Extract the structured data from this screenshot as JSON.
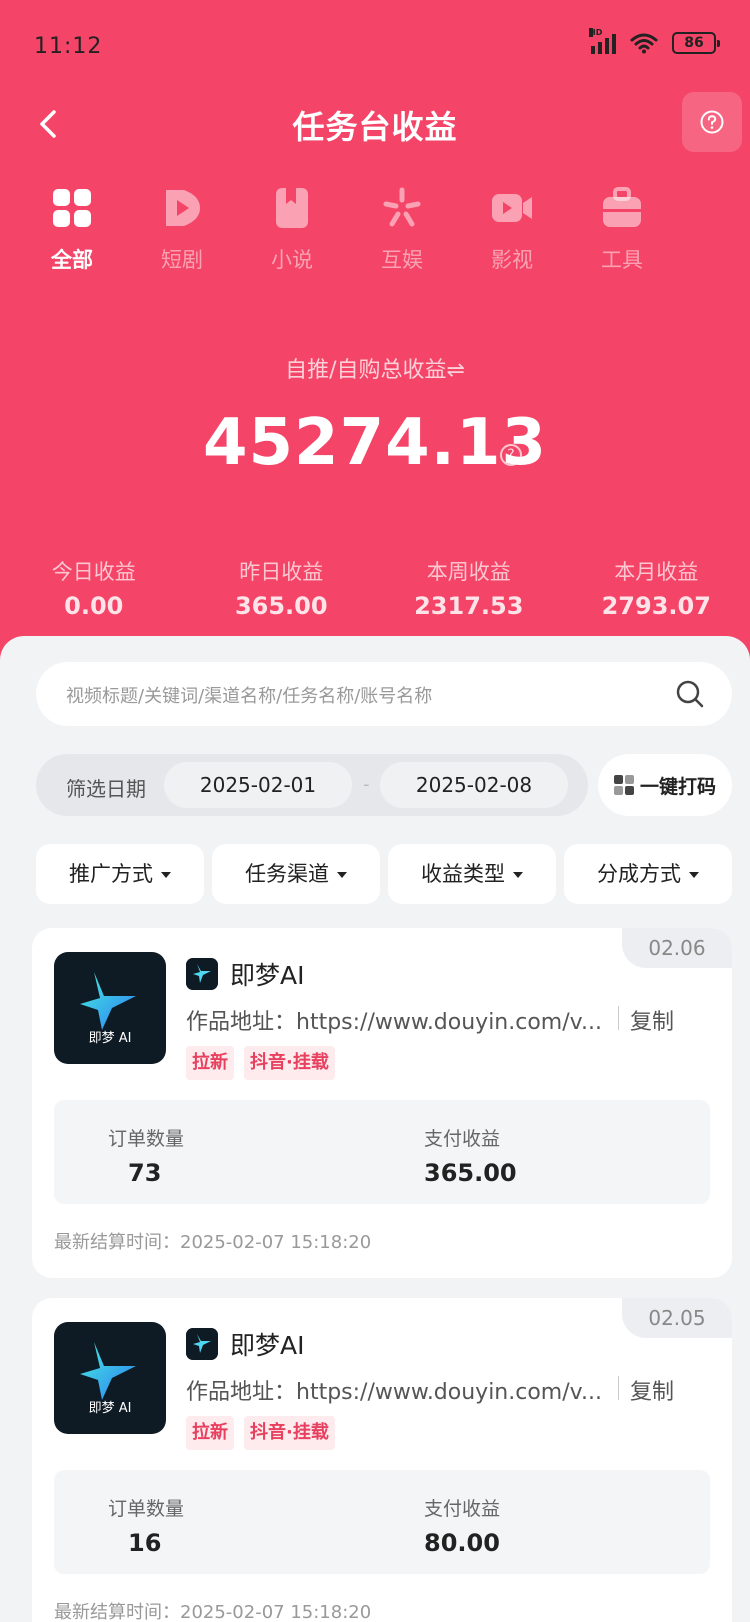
{
  "status_bar": {
    "time": "11:12",
    "network": "HD",
    "battery": "86"
  },
  "header": {
    "title": "任务台收益"
  },
  "categories": [
    {
      "label": "全部",
      "icon": "grid-icon",
      "active": true
    },
    {
      "label": "短剧",
      "icon": "play-icon",
      "active": false
    },
    {
      "label": "小说",
      "icon": "book-icon",
      "active": false
    },
    {
      "label": "互娱",
      "icon": "sparkle-icon",
      "active": false
    },
    {
      "label": "影视",
      "icon": "video-icon",
      "active": false
    },
    {
      "label": "工具",
      "icon": "toolbox-icon",
      "active": false
    }
  ],
  "summary": {
    "label": "自推/自购总收益⇌",
    "total": "45274.13",
    "stats": [
      {
        "label": "今日收益",
        "value": "0.00"
      },
      {
        "label": "昨日收益",
        "value": "365.00"
      },
      {
        "label": "本周收益",
        "value": "2317.53"
      },
      {
        "label": "本月收益",
        "value": "2793.07"
      }
    ]
  },
  "search": {
    "placeholder": "视频标题/关键词/渠道名称/任务名称/账号名称"
  },
  "date_filter": {
    "label": "筛选日期",
    "start": "2025-02-01",
    "separator": "-",
    "end": "2025-02-08"
  },
  "qr_button": {
    "label": "一键打码"
  },
  "filters": [
    {
      "label": "推广方式"
    },
    {
      "label": "任务渠道"
    },
    {
      "label": "收益类型"
    },
    {
      "label": "分成方式"
    }
  ],
  "cards": [
    {
      "date": "02.06",
      "logo_text": "即梦 AI",
      "app_name": "即梦AI",
      "address": "作品地址：https://www.douyin.com/v...",
      "copy_label": "复制",
      "tags": [
        "拉新",
        "抖音·挂载"
      ],
      "order_label": "订单数量",
      "order_value": "73",
      "pay_label": "支付收益",
      "pay_value": "365.00",
      "settle": "最新结算时间：2025-02-07 15:18:20"
    },
    {
      "date": "02.05",
      "logo_text": "即梦 AI",
      "app_name": "即梦AI",
      "address": "作品地址：https://www.douyin.com/v...",
      "copy_label": "复制",
      "tags": [
        "拉新",
        "抖音·挂载"
      ],
      "order_label": "订单数量",
      "order_value": "16",
      "pay_label": "支付收益",
      "pay_value": "80.00",
      "settle": "最新结算时间：2025-02-07 15:18:20"
    }
  ],
  "colors": {
    "accent": "#f44467",
    "tag_bg": "#fdebee",
    "tag_text": "#e8415f"
  }
}
